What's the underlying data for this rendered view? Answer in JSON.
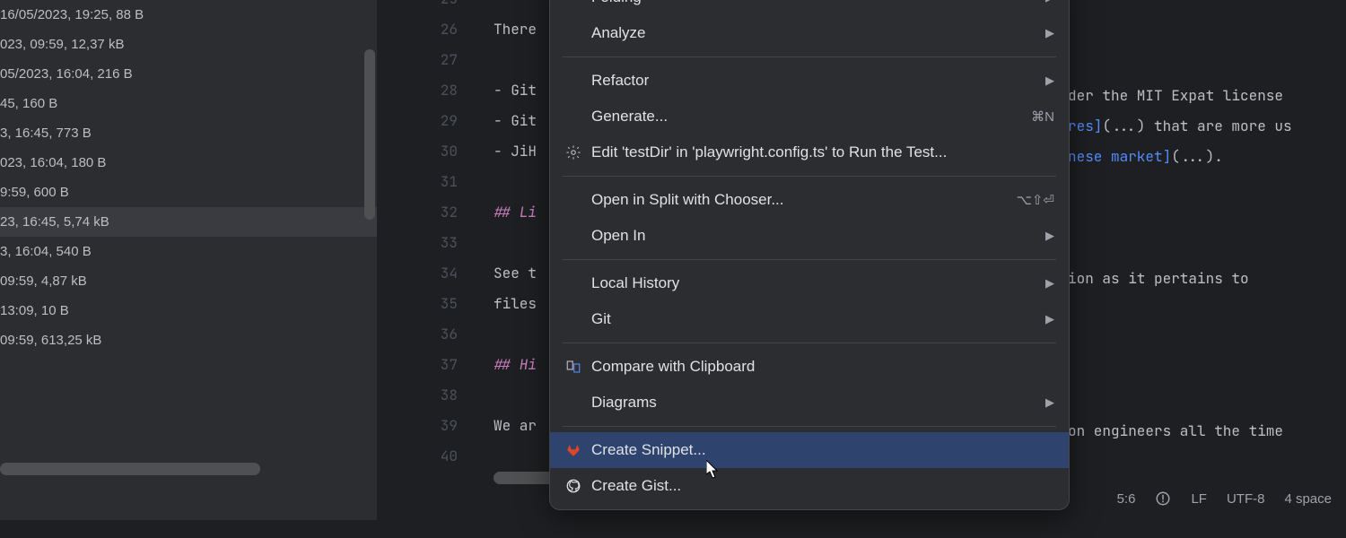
{
  "file_tree": {
    "items": [
      {
        "meta": "16/05/2023, 19:25, 88 B",
        "selected": false
      },
      {
        "meta": "023, 09:59, 12,37 kB",
        "selected": false
      },
      {
        "meta": "05/2023, 16:04, 216 B",
        "selected": false
      },
      {
        "meta": "45, 160 B",
        "selected": false
      },
      {
        "meta": "3, 16:45, 773 B",
        "selected": false
      },
      {
        "meta": "023, 16:04, 180 B",
        "selected": false
      },
      {
        "meta": "9:59, 600 B",
        "selected": false
      },
      {
        "meta": "23, 16:45, 5,74 kB",
        "selected": true
      },
      {
        "meta": "3, 16:04, 540 B",
        "selected": false
      },
      {
        "meta": "09:59, 4,87 kB",
        "selected": false
      },
      {
        "meta": "13:09, 10 B",
        "selected": false
      },
      {
        "meta": "09:59, 613,25 kB",
        "selected": false
      }
    ]
  },
  "gutter": [
    "26",
    "27",
    "28",
    "29",
    "30",
    "31",
    "32",
    "33",
    "34",
    "35",
    "36",
    "37",
    "38",
    "39",
    "40"
  ],
  "editor_lines": [
    {
      "text": "There"
    },
    {
      "text": ""
    },
    {
      "text": "- Git"
    },
    {
      "text": "- Git"
    },
    {
      "text": "- JiH"
    },
    {
      "text": ""
    },
    {
      "text": "## Li",
      "heading": true
    },
    {
      "text": ""
    },
    {
      "text": "See t"
    },
    {
      "text": "files"
    },
    {
      "text": ""
    },
    {
      "text": "## Hi",
      "heading": true
    },
    {
      "text": ""
    },
    {
      "text": "We ar"
    },
    {
      "text": ""
    }
  ],
  "editor_right": [
    {
      "pre": "der the MIT Expat license"
    },
    {
      "pre": "",
      "link": "res]",
      "post": "(...) that are more us"
    },
    {
      "pre": "",
      "link": "nese market]",
      "post": "(...)."
    },
    {
      "pre": ""
    },
    {
      "pre": ""
    },
    {
      "pre": ""
    },
    {
      "pre": "ion as it pertains to"
    },
    {
      "pre": ""
    },
    {
      "pre": ""
    },
    {
      "pre": ""
    },
    {
      "pre": ""
    },
    {
      "pre": "on engineers all the time"
    }
  ],
  "context_menu": {
    "groups": [
      [
        {
          "label": "Folding",
          "submenu": true
        },
        {
          "label": "Analyze",
          "submenu": true
        }
      ],
      [
        {
          "label": "Refactor",
          "submenu": true
        },
        {
          "label": "Generate...",
          "shortcut": "⌘N"
        },
        {
          "label": "Edit 'testDir' in 'playwright.config.ts' to Run the Test...",
          "icon": "gear"
        }
      ],
      [
        {
          "label": "Open in Split with Chooser...",
          "shortcut": "⌥⇧⏎"
        },
        {
          "label": "Open In",
          "submenu": true
        }
      ],
      [
        {
          "label": "Local History",
          "submenu": true
        },
        {
          "label": "Git",
          "submenu": true
        }
      ],
      [
        {
          "label": "Compare with Clipboard",
          "icon": "compare"
        },
        {
          "label": "Diagrams",
          "submenu": true
        }
      ],
      [
        {
          "label": "Create Snippet...",
          "icon": "gitlab",
          "highlighted": true
        },
        {
          "label": "Create Gist...",
          "icon": "github"
        }
      ]
    ]
  },
  "status_bar": {
    "position": "5:6",
    "encoding_lf": "LF",
    "encoding": "UTF-8",
    "indent": "4 space"
  }
}
